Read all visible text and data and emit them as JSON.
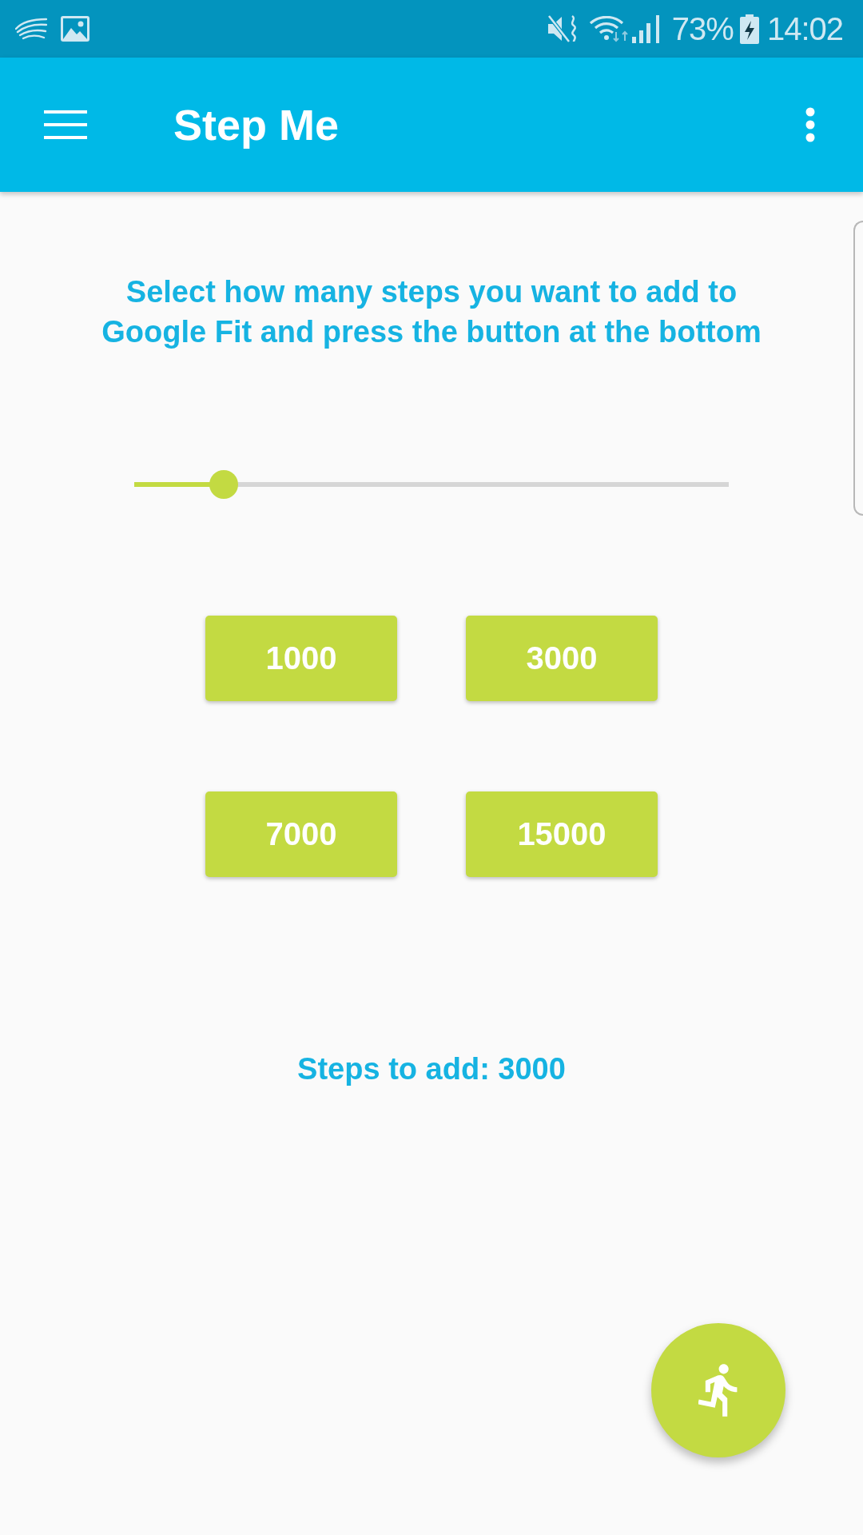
{
  "status_bar": {
    "battery": "73%",
    "time": "14:02"
  },
  "app_bar": {
    "title": "Step Me"
  },
  "instruction": "Select how many steps you want to add to Google Fit and press the button at the bottom",
  "slider": {
    "level": 0.15
  },
  "step_buttons": [
    "1000",
    "3000",
    "7000",
    "15000"
  ],
  "steps_label": "Steps to add: 3000"
}
